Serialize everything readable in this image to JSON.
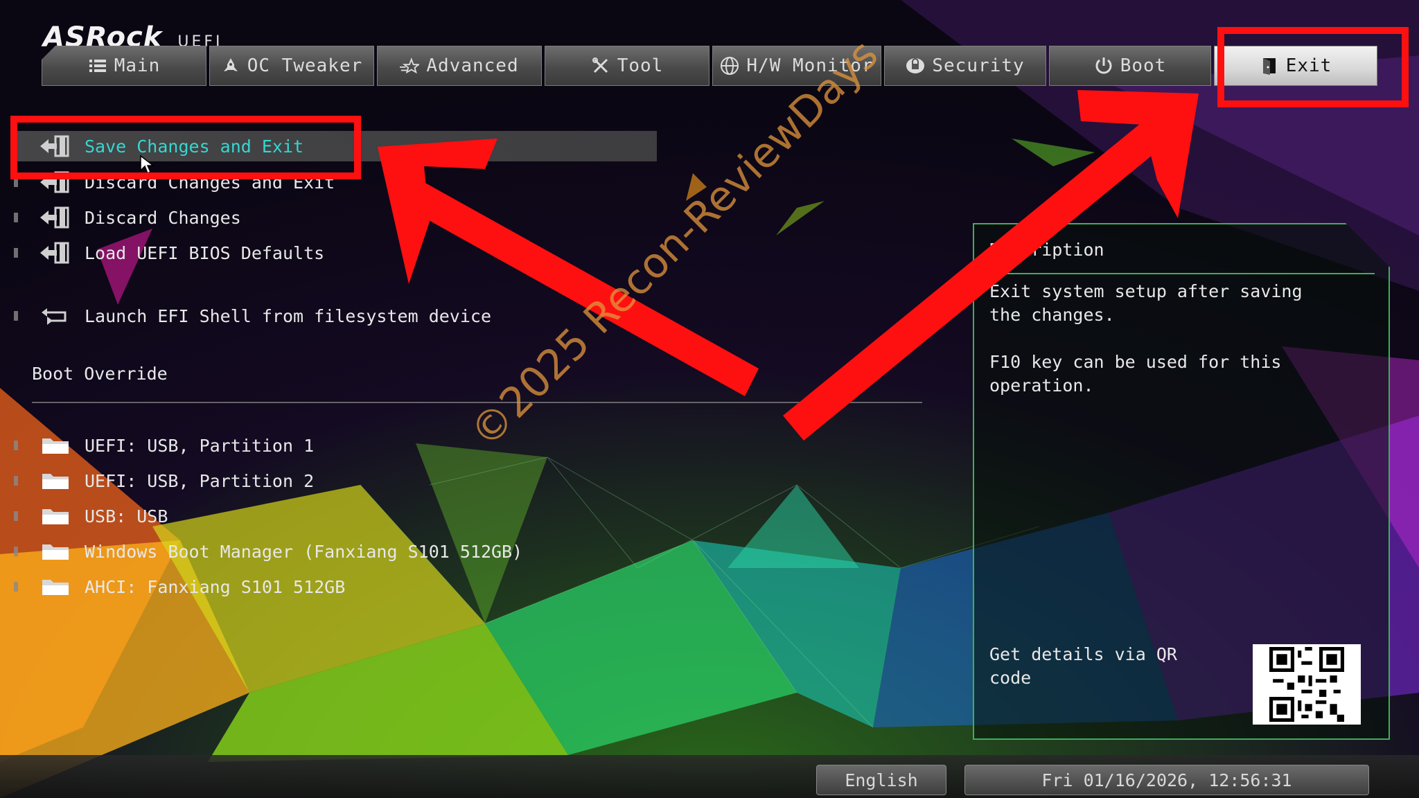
{
  "header": {
    "brand": "ASRock",
    "firmware": "UEFI"
  },
  "tabs": [
    {
      "label": "Main",
      "icon": "list-icon"
    },
    {
      "label": "OC Tweaker",
      "icon": "rocket-icon"
    },
    {
      "label": "Advanced",
      "icon": "star-icon"
    },
    {
      "label": "Tool",
      "icon": "tools-icon"
    },
    {
      "label": "H/W Monitor",
      "icon": "monitor-icon"
    },
    {
      "label": "Security",
      "icon": "shield-icon"
    },
    {
      "label": "Boot",
      "icon": "power-icon"
    },
    {
      "label": "Exit",
      "icon": "exit-door-icon",
      "active": true
    }
  ],
  "menu": {
    "items": [
      {
        "label": "Save Changes and Exit",
        "selected": true
      },
      {
        "label": "Discard Changes and Exit"
      },
      {
        "label": "Discard Changes"
      },
      {
        "label": "Load UEFI BIOS Defaults"
      },
      {
        "label": "Launch EFI Shell from filesystem device"
      }
    ],
    "boot_override_heading": "Boot Override",
    "boot_devices": [
      "UEFI:  USB, Partition 1",
      "UEFI:  USB, Partition 2",
      "USB:  USB",
      "Windows Boot Manager (Fanxiang S101 512GB)",
      "AHCI:  Fanxiang S101 512GB"
    ]
  },
  "description": {
    "title": "Description",
    "text": "Exit system setup after saving\nthe changes.\n\nF10 key can be used for this\noperation.",
    "qr_label": "Get details via QR code"
  },
  "footer": {
    "language": "English",
    "datetime": "Fri 01/16/2026, 12:56:31"
  },
  "watermark": "©2025 Recon-ReviewDays",
  "colors": {
    "accent": "#35d7d0",
    "panel_border": "#3fae5b",
    "annotation": "#ff1010"
  }
}
